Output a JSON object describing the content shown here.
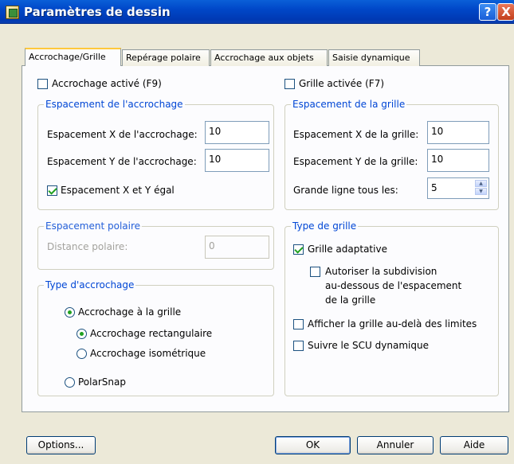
{
  "window": {
    "title": "Paramètres de dessin",
    "help_label": "?",
    "close_label": "X"
  },
  "tabs": [
    {
      "label": "Accrochage/Grille"
    },
    {
      "label": "Repérage polaire"
    },
    {
      "label": "Accrochage aux objets"
    },
    {
      "label": "Saisie dynamique"
    }
  ],
  "snap": {
    "enabled_label": "Accrochage activé (F9)",
    "enabled_checked": false,
    "spacing_group": "Espacement de l'accrochage",
    "x_label": "Espacement X de l'accrochage:",
    "x_value": "10",
    "y_label": "Espacement Y de l'accrochage:",
    "y_value": "10",
    "equal_label": "Espacement X et Y égal",
    "equal_checked": true
  },
  "polar": {
    "group": "Espacement polaire",
    "distance_label": "Distance polaire:",
    "distance_value": "0"
  },
  "snap_type": {
    "group": "Type d'accrochage",
    "grid_snap_label": "Accrochage à la grille",
    "rect_label": "Accrochage rectangulaire",
    "iso_label": "Accrochage isométrique",
    "polarsnap_label": "PolarSnap",
    "selected": "grid_snap",
    "grid_sub_selected": "rect"
  },
  "grid": {
    "enabled_label": "Grille activée (F7)",
    "enabled_checked": false,
    "spacing_group": "Espacement de la grille",
    "x_label": "Espacement X de la grille:",
    "x_value": "10",
    "y_label": "Espacement Y de la grille:",
    "y_value": "10",
    "major_label": "Grande ligne tous les:",
    "major_value": "5"
  },
  "grid_type": {
    "group": "Type de grille",
    "adaptive_label": "Grille adaptative",
    "adaptive_checked": true,
    "subdiv_line1": "Autoriser la subdivision",
    "subdiv_line2": "au-dessous de l'espacement",
    "subdiv_line3": "de la grille",
    "subdiv_checked": false,
    "beyond_limits_label": "Afficher la grille au-delà des limites",
    "beyond_limits_checked": false,
    "follow_ucs_label": "Suivre le SCU dynamique",
    "follow_ucs_checked": false
  },
  "buttons": {
    "options": "Options...",
    "ok": "OK",
    "cancel": "Annuler",
    "help": "Aide"
  }
}
